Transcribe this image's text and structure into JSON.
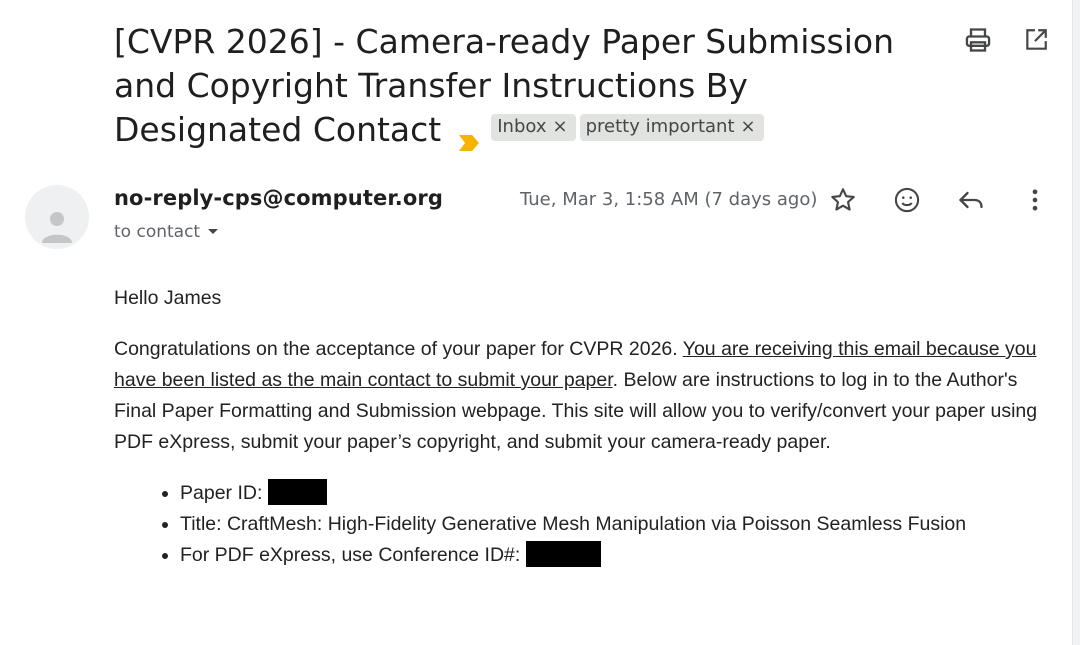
{
  "subject": {
    "title": "[CVPR 2026] - Camera-ready Paper Submission and Copyright Transfer Instructions By Designated Contact",
    "labels": [
      {
        "label": "Inbox",
        "remove": "×"
      },
      {
        "label": "pretty important",
        "remove": "×"
      }
    ],
    "importance_color": "#f4b400"
  },
  "toolbar": {
    "print_icon": "print-icon",
    "open_new_window_icon": "open-in-new-icon"
  },
  "message": {
    "sender": "no-reply-cps@computer.org",
    "to": "to contact",
    "date": "Tue, Mar 3, 1:58 AM (7 days ago)",
    "actions": [
      "star-icon",
      "emoji-icon",
      "reply-icon",
      "more-vert-icon"
    ]
  },
  "body": {
    "greeting": "Hello James",
    "para1_start": "Congratulations on the acceptance of your paper for CVPR 2026. ",
    "para1_underlined": "You are receiving this email because you have been listed as the main contact to submit your paper",
    "para1_end": ". Below are instructions to log in to the Author's Final Paper Formatting and Submission webpage. This site will allow you to verify/convert your paper using PDF eXpress, submit your paper’s copyright, and submit your camera-ready paper.",
    "bullets": {
      "paper_id": "Paper ID:",
      "title": "Title: CraftMesh: High-Fidelity Generative Mesh Manipulation via Poisson Seamless Fusion",
      "conference_id": "For PDF eXpress, use Conference ID#:"
    }
  }
}
